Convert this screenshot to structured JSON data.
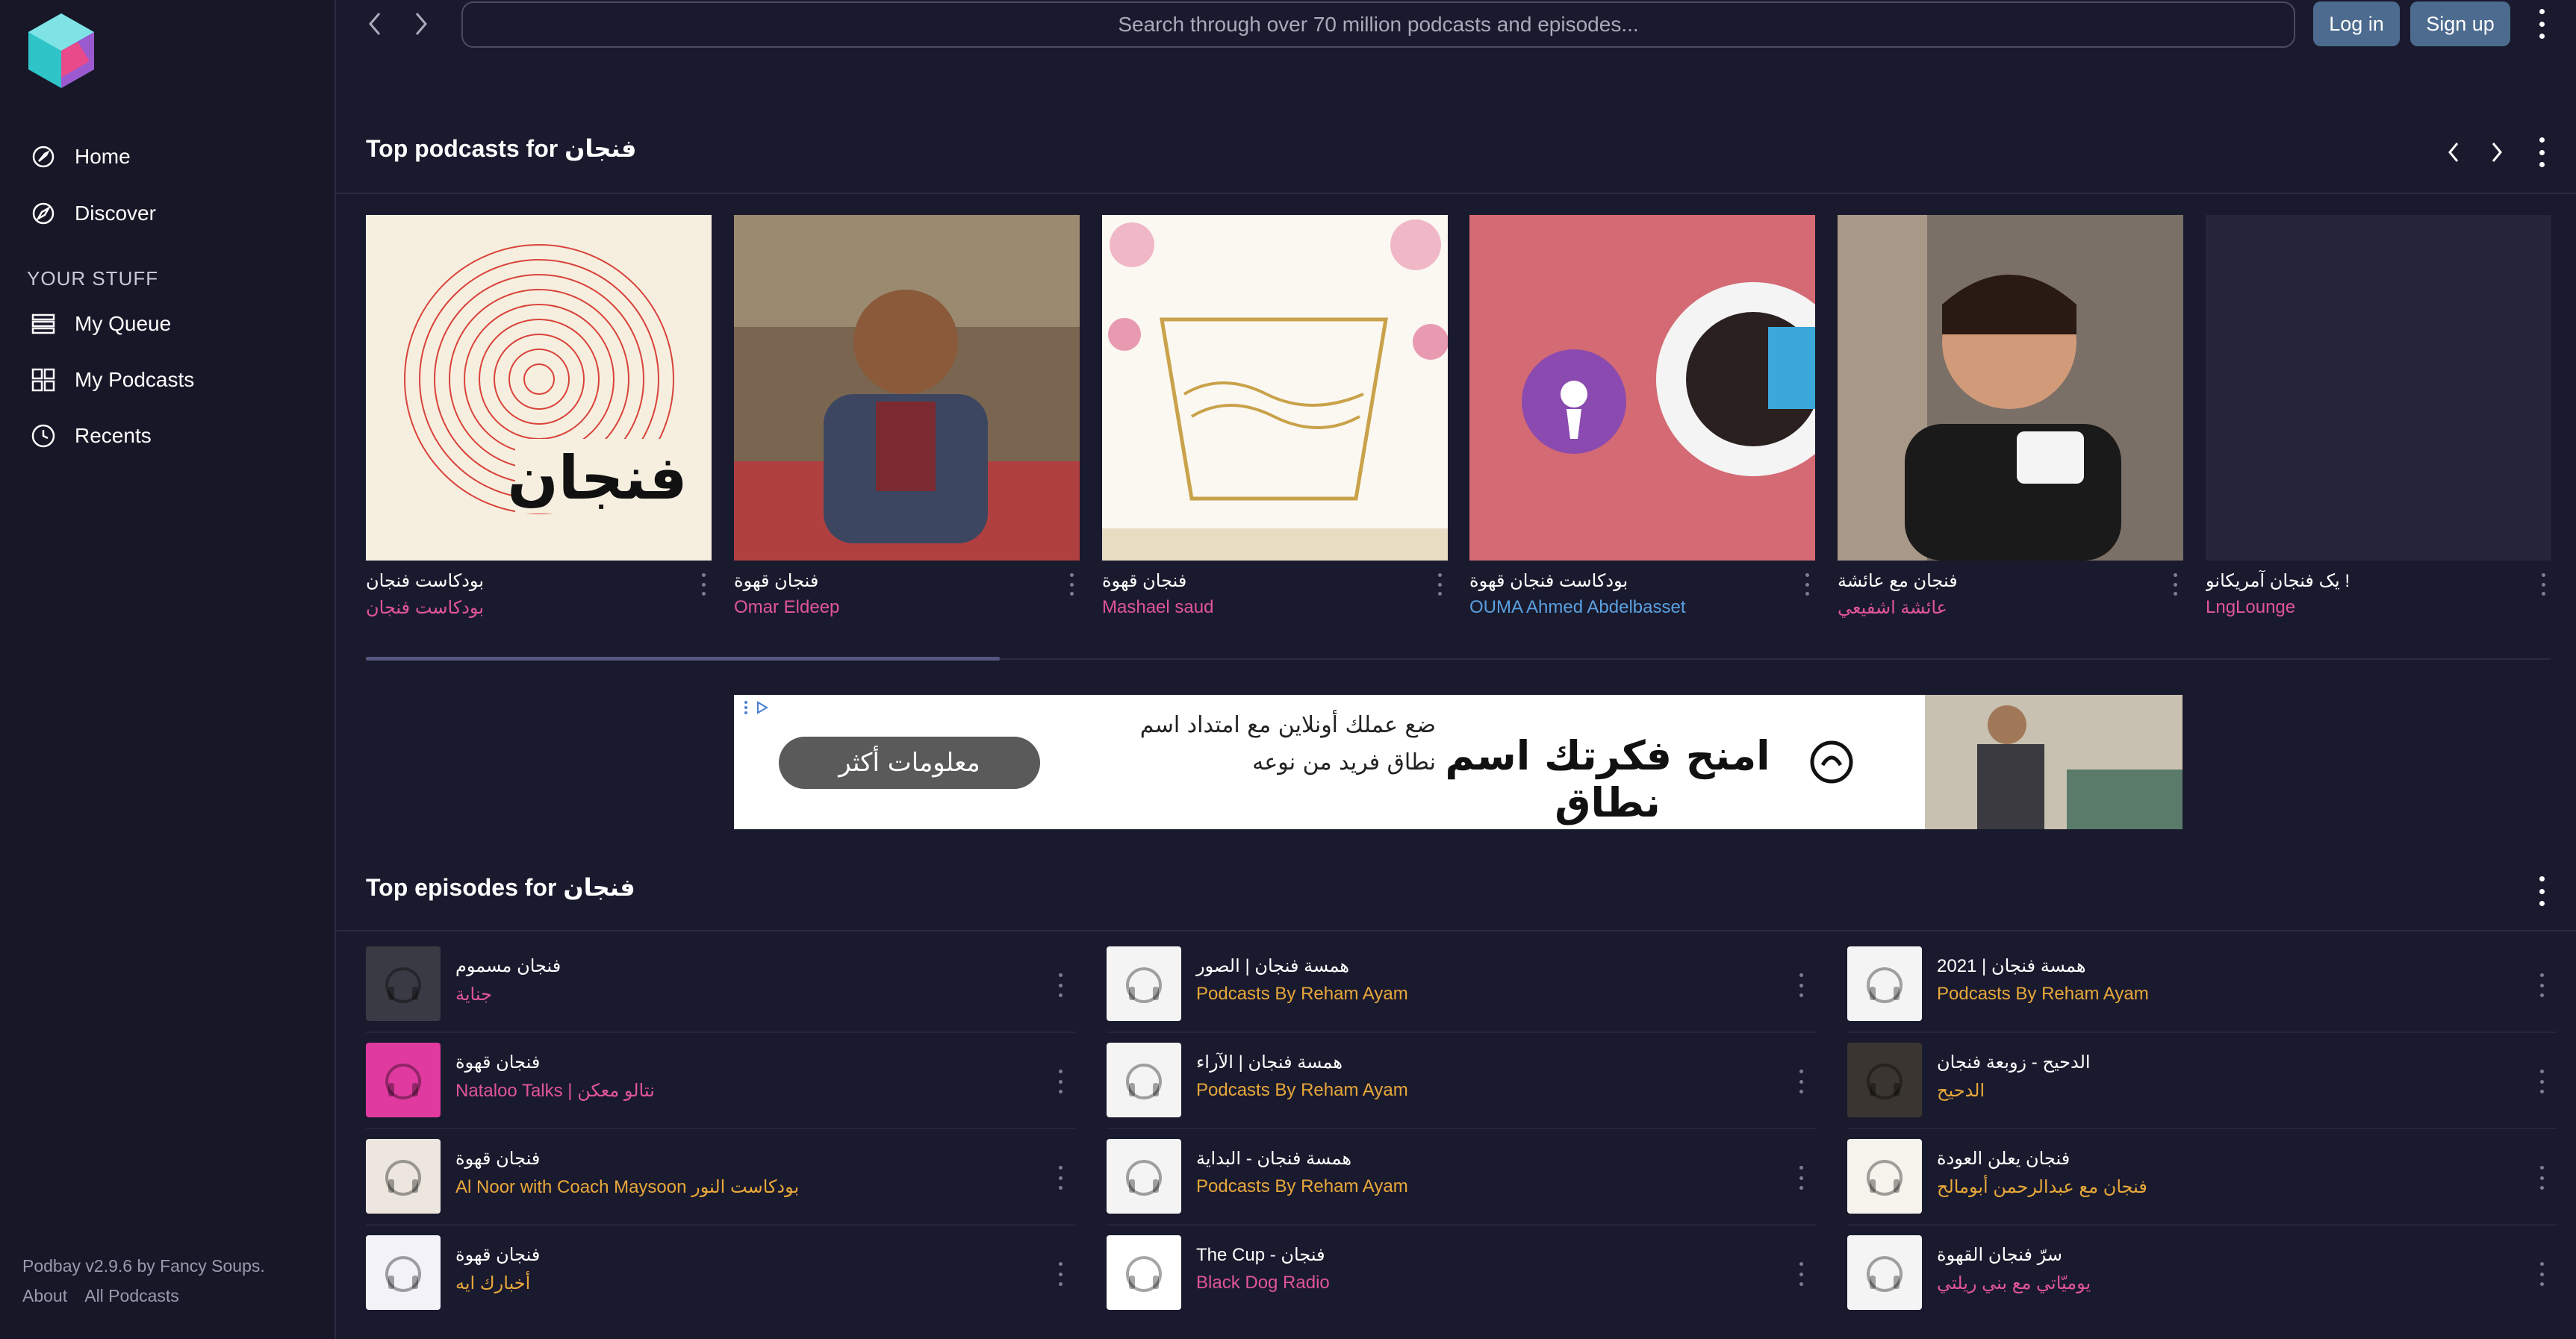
{
  "app": {
    "version_text": "Podbay v2.9.6 by Fancy Soups.",
    "footer_links": [
      "About",
      "All Podcasts"
    ]
  },
  "sidebar": {
    "items": [
      {
        "label": "Home",
        "icon": "home-icon"
      },
      {
        "label": "Discover",
        "icon": "discover-icon"
      }
    ],
    "section_title": "YOUR STUFF",
    "stuff_items": [
      {
        "label": "My Queue",
        "icon": "queue-icon"
      },
      {
        "label": "My Podcasts",
        "icon": "grid-icon"
      },
      {
        "label": "Recents",
        "icon": "clock-icon"
      }
    ]
  },
  "header": {
    "search_placeholder": "Search through over 70 million podcasts and episodes...",
    "login": "Log in",
    "signup": "Sign up"
  },
  "top_podcasts": {
    "heading": "Top podcasts for فنجان",
    "cards": [
      {
        "title": "بودكاست فنجان",
        "author": "بودكاست فنجان",
        "author_color": "#e0559a",
        "art": "rings"
      },
      {
        "title": "فنجان قهوة",
        "author": "Omar Eldeep",
        "author_color": "#e0559a",
        "art": "photo-man"
      },
      {
        "title": "فنجان قهوة",
        "author": "Mashael saud",
        "author_color": "#e0559a",
        "art": "cup"
      },
      {
        "title": "بودكاست فنجان قهوة",
        "author": "OUMA Ahmed Abdelbasset",
        "author_color": "#5aa0e0",
        "art": "pink-coffee"
      },
      {
        "title": "فنجان مع عائشة",
        "author": "عائشة اشفيعي",
        "author_color": "#e0559a",
        "art": "photo-woman"
      },
      {
        "title": "یک فنجان آمریکانو !",
        "author": "LngLounge",
        "author_color": "#e0559a",
        "art": "blank"
      }
    ],
    "scroll_progress": 0.29
  },
  "ad": {
    "button": "معلومات أكثر",
    "description": "ضع عملك أونلاين مع امتداد اسم نطاق فريد من نوعه",
    "headline": "امنح فكرتك اسم نطاق"
  },
  "top_episodes": {
    "heading": "Top episodes for فنجان",
    "columns": [
      [
        {
          "title": "فنجان مسموم",
          "author": "جناية",
          "author_color": "#e0559a",
          "thumb": "#3a3a44"
        },
        {
          "title": "فنجان قهوة",
          "author": "Nataloo Talks | نتالو معكن",
          "author_color": "#e0559a",
          "thumb": "#e03aa0"
        },
        {
          "title": "فنجان قهوة",
          "author": "Al Noor with Coach Maysoon بودكاست النور",
          "author_color": "#e8a83a",
          "thumb": "#ece6de"
        },
        {
          "title": "فنجان قهوة",
          "author": "أخبارك ايه",
          "author_color": "#e8a83a",
          "thumb": "#f2f2f8"
        }
      ],
      [
        {
          "title": "همسة فنجان | الصور",
          "author": "Podcasts By Reham Ayam",
          "author_color": "#e8a83a",
          "thumb": "#f4f4f4"
        },
        {
          "title": "همسة فنجان | الآراء",
          "author": "Podcasts By Reham Ayam",
          "author_color": "#e8a83a",
          "thumb": "#f4f4f4"
        },
        {
          "title": "همسة فنجان - البداية",
          "author": "Podcasts By Reham Ayam",
          "author_color": "#e8a83a",
          "thumb": "#f4f4f4"
        },
        {
          "title": "The Cup - فنجان",
          "author": "Black Dog Radio",
          "author_color": "#e0559a",
          "thumb": "#ffffff"
        }
      ],
      [
        {
          "title": "همسة فنجان | 2021",
          "author": "Podcasts By Reham Ayam",
          "author_color": "#e8a83a",
          "thumb": "#f4f4f4"
        },
        {
          "title": "الدحيح - زوبعة فنجان",
          "author": "الدحيح",
          "author_color": "#e8a83a",
          "thumb": "#3a3530"
        },
        {
          "title": "فنجان يعلن العودة",
          "author": "فنجان مع عبدالرحمن أبومالح",
          "author_color": "#e8a83a",
          "thumb": "#f6f2ec"
        },
        {
          "title": "سرّ فنجان القهوة",
          "author": "يوميّاتي مع بني ريلتي",
          "author_color": "#e0559a",
          "thumb": "#f4f4f4"
        }
      ]
    ]
  }
}
